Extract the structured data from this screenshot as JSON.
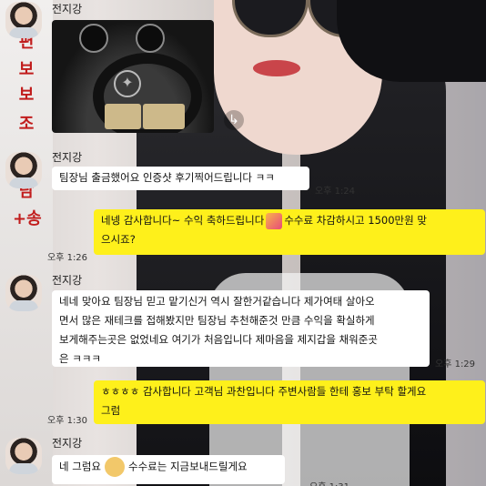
{
  "contact": {
    "name": "전지강"
  },
  "sign": {
    "chars": [
      "편",
      "보",
      "보",
      "조",
      "담",
      "+송"
    ]
  },
  "messages": [
    {
      "id": "m1",
      "side": "left",
      "text": "팀장님 출금했어요 인증샷 후기찍어드립니다 ㅋㅋ",
      "time": "오후 1:24"
    },
    {
      "id": "m2",
      "side": "right",
      "line1": "네넹 감사합니다~ 수익 축하드립니다",
      "line1b": "수수료 차감하시고 1500만원 맞",
      "line2": "으시죠?",
      "time": "오후 1:26"
    },
    {
      "id": "m3",
      "side": "left",
      "lines": [
        "네네 맞아요 팀장님 믿고 맡기신거 역시 잘한거같습니다 제가여태 살아오",
        "면서 많은 재테크를 접해봤지만 팀장님 추천해준것 만큼 수익을 확실하게",
        "보게해주는곳은 없었네요 여기가 처음입니다 제마음을 제지갑을 채워준곳",
        "은 ㅋㅋㅋ"
      ],
      "time": "오후 1:29"
    },
    {
      "id": "m4",
      "side": "right",
      "lines": [
        "ㅎㅎㅎㅎ 감사합니다 고객님 과찬입니다 주변사람들 한테 홍보 부탁 할게요",
        "그럼"
      ],
      "time": "오후 1:30"
    },
    {
      "id": "m5",
      "side": "left",
      "textA": "네 그럼요",
      "textB": "수수료는 지금보내드릴게요",
      "time": "오후 1:31"
    }
  ],
  "icons": {
    "share": "share-icon",
    "party": "party-popper-icon",
    "sticker": "emoticon-icon",
    "car_logo": "mercedes-logo-icon"
  },
  "colors": {
    "bubble_yellow": "#fef01b",
    "bubble_white": "#ffffff"
  }
}
